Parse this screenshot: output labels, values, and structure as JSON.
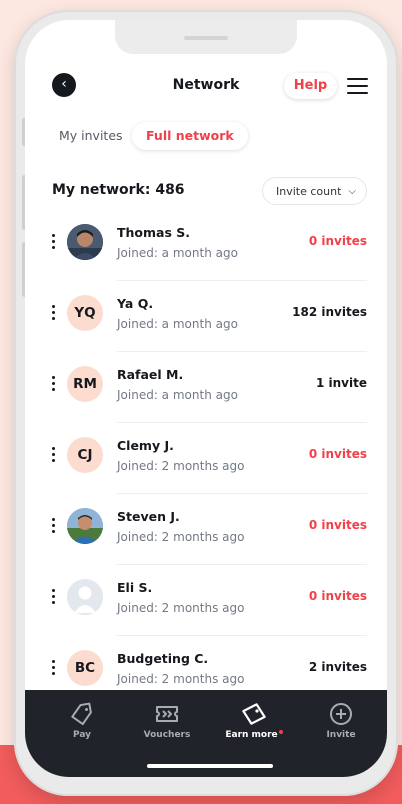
{
  "header": {
    "title": "Network",
    "help_label": "Help"
  },
  "tabs": {
    "my_invites": "My invites",
    "full_network": "Full network"
  },
  "network": {
    "count_label": "My network: 486",
    "sort_label": "Invite count"
  },
  "members": [
    {
      "name": "Thomas S.",
      "joined": "Joined: a month ago",
      "invites": "0 invites",
      "avatar": "photo"
    },
    {
      "name": "Ya Q.",
      "joined": "Joined: a month ago",
      "invites": "182 invites",
      "initials": "YQ"
    },
    {
      "name": "Rafael M.",
      "joined": "Joined: a month ago",
      "invites": "1 invite",
      "initials": "RM"
    },
    {
      "name": "Clemy J.",
      "joined": "Joined: 2 months ago",
      "invites": "0 invites",
      "initials": "CJ"
    },
    {
      "name": "Steven J.",
      "joined": "Joined: 2 months ago",
      "invites": "0 invites",
      "avatar": "photo"
    },
    {
      "name": "Eli S.",
      "joined": "Joined: 2 months ago",
      "invites": "0 invites",
      "avatar": "placeholder"
    },
    {
      "name": "Budgeting C.",
      "joined": "Joined: 2 months ago",
      "invites": "2 invites",
      "initials": "BC"
    }
  ],
  "nav": {
    "pay": "Pay",
    "vouchers": "Vouchers",
    "earn_more": "Earn more",
    "invite": "Invite"
  },
  "colors": {
    "accent": "#f2404a",
    "background_tint": "#fde8e1",
    "tabbar": "#20242a",
    "initials_avatar": "#fcdccf"
  },
  "icons": {
    "back": "chevron-left-icon",
    "menu": "hamburger-menu-icon",
    "sort": "chevron-down-icon",
    "pay": "tag-icon",
    "vouchers": "ticket-icon",
    "earn_more": "tag-diamond-icon",
    "invite": "plus-circle-icon"
  }
}
